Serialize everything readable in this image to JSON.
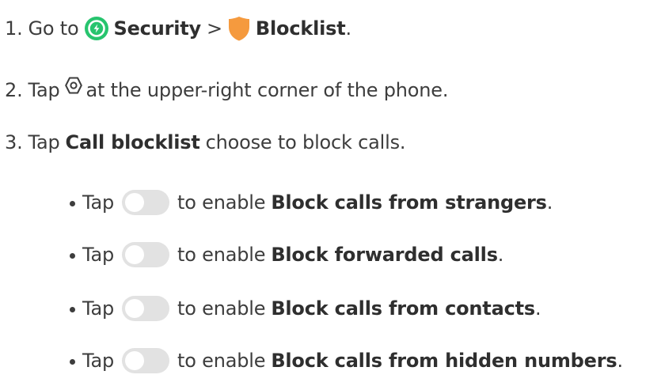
{
  "steps": [
    {
      "number": "1.",
      "text_go_to": "Go to",
      "security": "Security",
      "separator": ">",
      "blocklist": "Blocklist",
      "period": "."
    },
    {
      "number": "2.",
      "text_tap": "Tap",
      "text_rest": "at the upper-right corner of the phone."
    },
    {
      "number": "3.",
      "text_tap": "Tap",
      "call_blocklist": "Call blocklist",
      "text_rest": "choose to block calls."
    }
  ],
  "bullets": [
    {
      "tap": "Tap",
      "to_enable": "to enable",
      "option": "Block calls from strangers",
      "period": "."
    },
    {
      "tap": "Tap",
      "to_enable": "to enable",
      "option": "Block forwarded calls",
      "period": "."
    },
    {
      "tap": "Tap",
      "to_enable": "to enable",
      "option": "Block calls from contacts",
      "period": "."
    },
    {
      "tap": "Tap",
      "to_enable": "to enable",
      "option": "Block calls from hidden numbers",
      "period": "."
    }
  ],
  "icons": {
    "security": "security-app-icon",
    "blocklist": "shield-icon",
    "settings": "settings-icon",
    "toggle": "toggle-off-icon"
  },
  "colors": {
    "text": "#3d3d3d",
    "security_green": "#27c46e",
    "shield_orange": "#f59a3e",
    "toggle_track": "#e2e2e2"
  }
}
